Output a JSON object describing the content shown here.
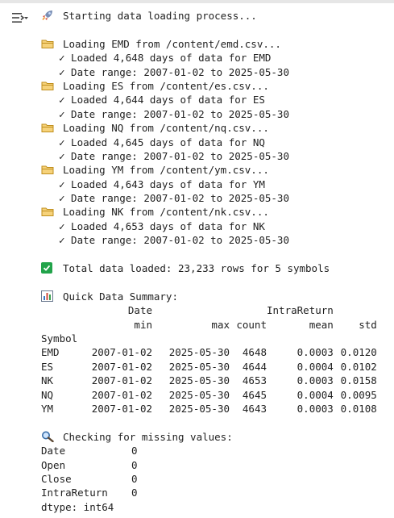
{
  "log": {
    "start": "Starting data loading process...",
    "symbols": [
      {
        "loading": "Loading EMD from /content/emd.csv...",
        "loaded": "✓ Loaded 4,648 days of data for EMD",
        "range": "✓ Date range: 2007-01-02 to 2025-05-30"
      },
      {
        "loading": "Loading ES from /content/es.csv...",
        "loaded": "✓ Loaded 4,644 days of data for ES",
        "range": "✓ Date range: 2007-01-02 to 2025-05-30"
      },
      {
        "loading": "Loading NQ from /content/nq.csv...",
        "loaded": "✓ Loaded 4,645 days of data for NQ",
        "range": "✓ Date range: 2007-01-02 to 2025-05-30"
      },
      {
        "loading": "Loading YM from /content/ym.csv...",
        "loaded": "✓ Loaded 4,643 days of data for YM",
        "range": "✓ Date range: 2007-01-02 to 2025-05-30"
      },
      {
        "loading": "Loading NK from /content/nk.csv...",
        "loaded": "✓ Loaded 4,653 days of data for NK",
        "range": "✓ Date range: 2007-01-02 to 2025-05-30"
      }
    ],
    "total": "Total data loaded: 23,233 rows for 5 symbols"
  },
  "summary": {
    "title": "Quick Data Summary:",
    "header1": {
      "date": "Date",
      "intrareturn": "IntraReturn"
    },
    "header2": {
      "min": "min",
      "max": "max",
      "count": "count",
      "mean": "mean",
      "std": "std"
    },
    "index_name": "Symbol",
    "rows": [
      {
        "symbol": "EMD",
        "min": "2007-01-02",
        "max": "2025-05-30",
        "count": "4648",
        "mean": "0.0003",
        "std": "0.0120"
      },
      {
        "symbol": "ES",
        "min": "2007-01-02",
        "max": "2025-05-30",
        "count": "4644",
        "mean": "0.0004",
        "std": "0.0102"
      },
      {
        "symbol": "NK",
        "min": "2007-01-02",
        "max": "2025-05-30",
        "count": "4653",
        "mean": "0.0003",
        "std": "0.0158"
      },
      {
        "symbol": "NQ",
        "min": "2007-01-02",
        "max": "2025-05-30",
        "count": "4645",
        "mean": "0.0004",
        "std": "0.0095"
      },
      {
        "symbol": "YM",
        "min": "2007-01-02",
        "max": "2025-05-30",
        "count": "4643",
        "mean": "0.0003",
        "std": "0.0108"
      }
    ]
  },
  "missing": {
    "title": "Checking for missing values:",
    "rows": [
      {
        "name": "Date",
        "value": "0"
      },
      {
        "name": "Open",
        "value": "0"
      },
      {
        "name": "Close",
        "value": "0"
      },
      {
        "name": "IntraReturn",
        "value": "0"
      }
    ],
    "dtype": "dtype: int64"
  },
  "icons": {
    "output_menu": "output-options-icon",
    "rocket": "rocket-icon",
    "folder": "folder-icon",
    "check": "check-mark-button-icon",
    "chart": "bar-chart-icon",
    "magnifier": "magnifying-glass-icon"
  },
  "colors": {
    "folder": "#e8b84a",
    "check_button": "#22a34a"
  }
}
